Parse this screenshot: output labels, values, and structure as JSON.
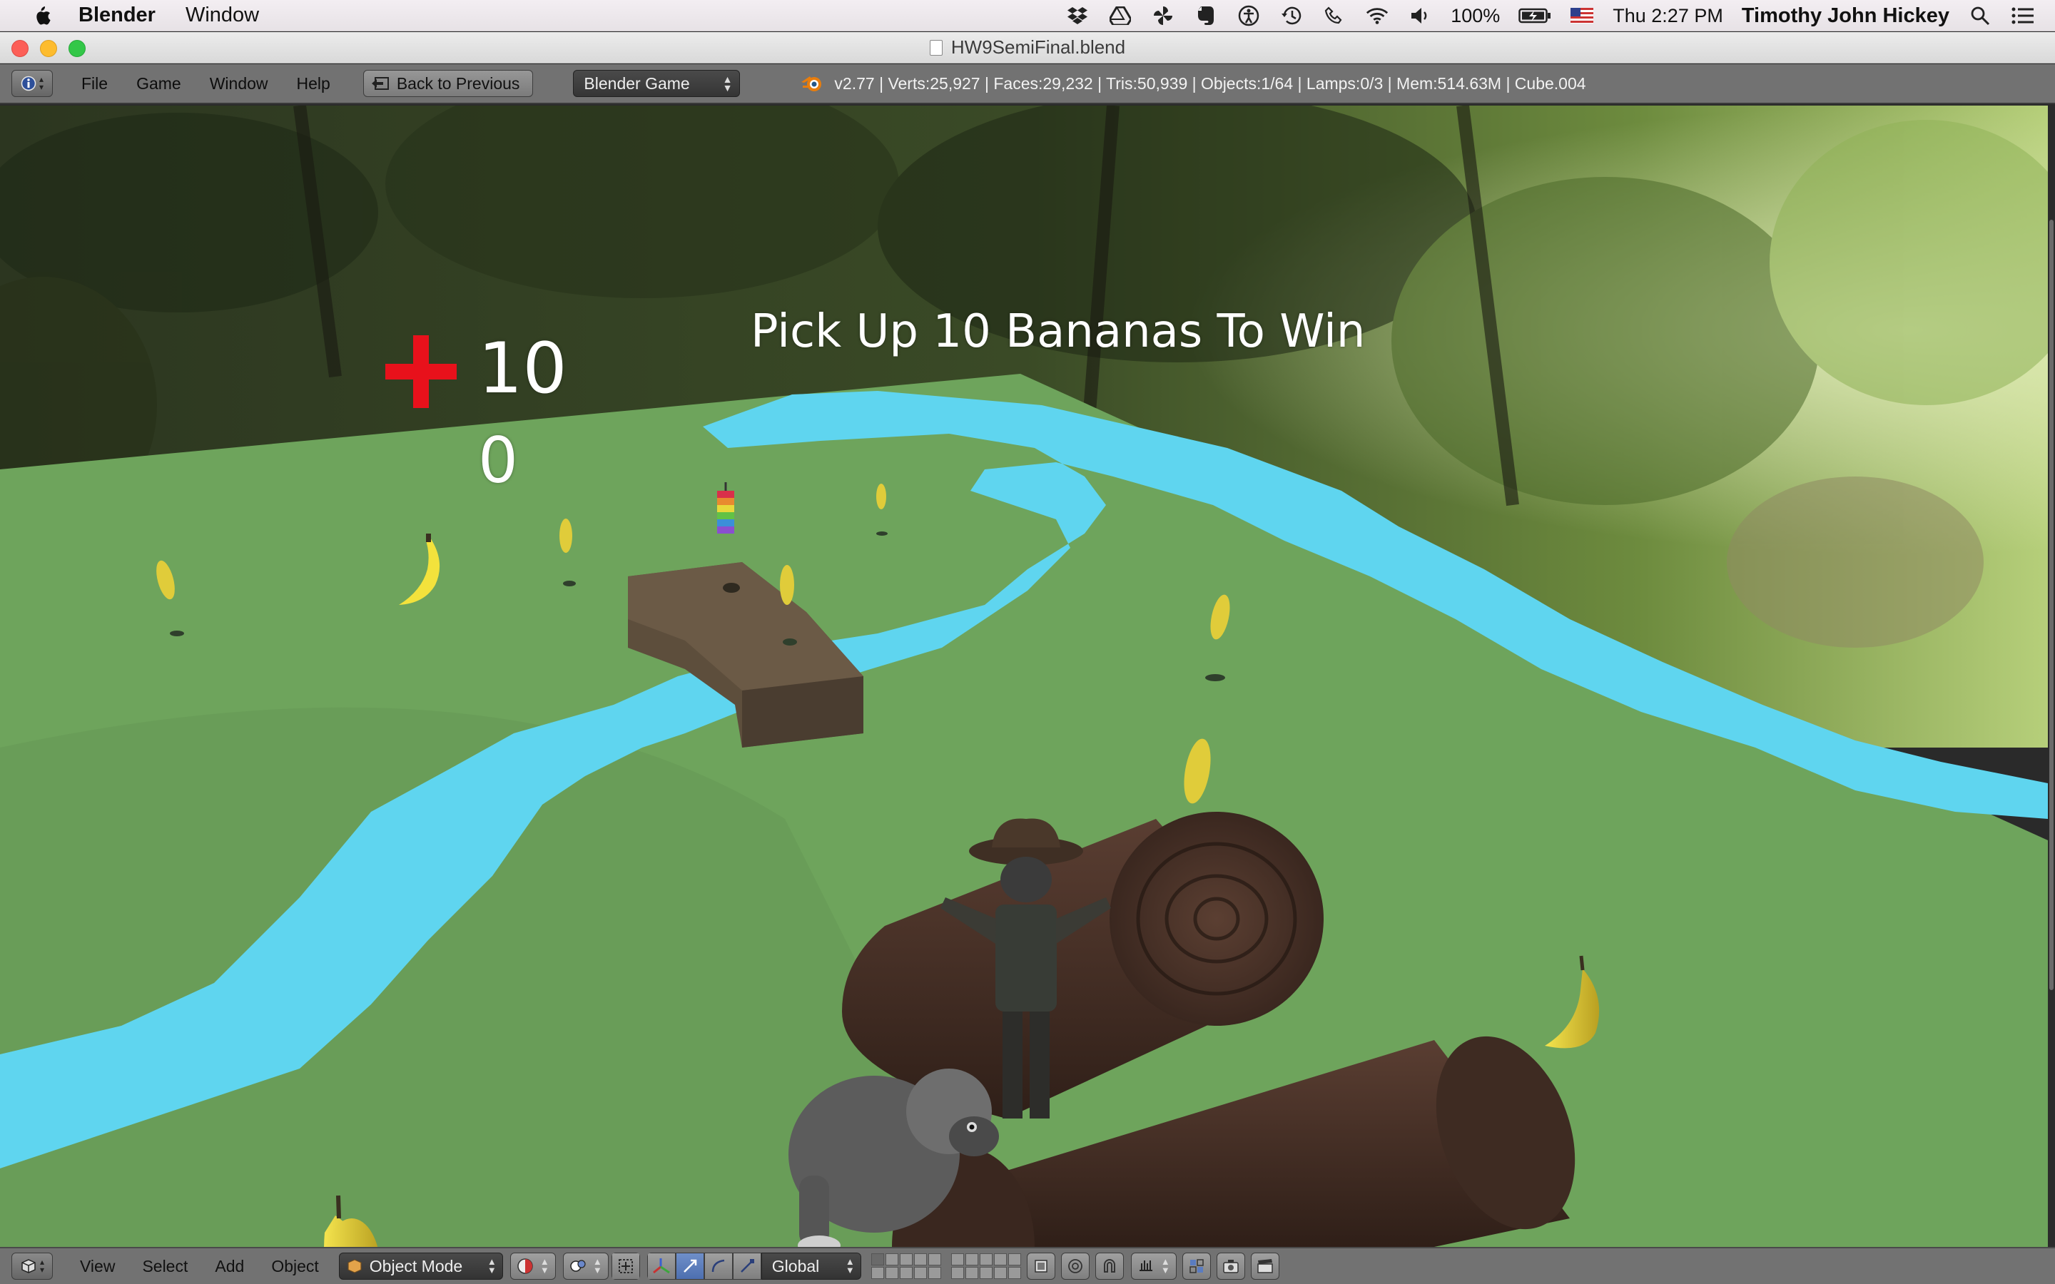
{
  "macos_menubar": {
    "app_name": "Blender",
    "menus": [
      "Window"
    ],
    "battery": "100%",
    "clock": "Thu 2:27 PM",
    "user": "Timothy John Hickey"
  },
  "window": {
    "title": "HW9SemiFinal.blend"
  },
  "info_header": {
    "menus": [
      "File",
      "Game",
      "Window",
      "Help"
    ],
    "back_button": "Back to Previous",
    "render_engine": "Blender Game",
    "stats": "v2.77 | Verts:25,927 | Faces:29,232 | Tris:50,939 | Objects:1/64 | Lamps:0/3 | Mem:514.63M | Cube.004"
  },
  "game_hud": {
    "objective": "Pick Up 10 Bananas To Win",
    "health": "10",
    "bananas": "0",
    "health_icon_color": "#e8111b"
  },
  "viewport_header": {
    "menus": [
      "View",
      "Select",
      "Add",
      "Object"
    ],
    "mode": "Object Mode",
    "orientation": "Global"
  },
  "colors": {
    "ground": "#6fa45e",
    "river": "#5fd5ef",
    "log": "#4a3228",
    "bridge": "#5e4d3b",
    "banana": "#e7d13c"
  }
}
